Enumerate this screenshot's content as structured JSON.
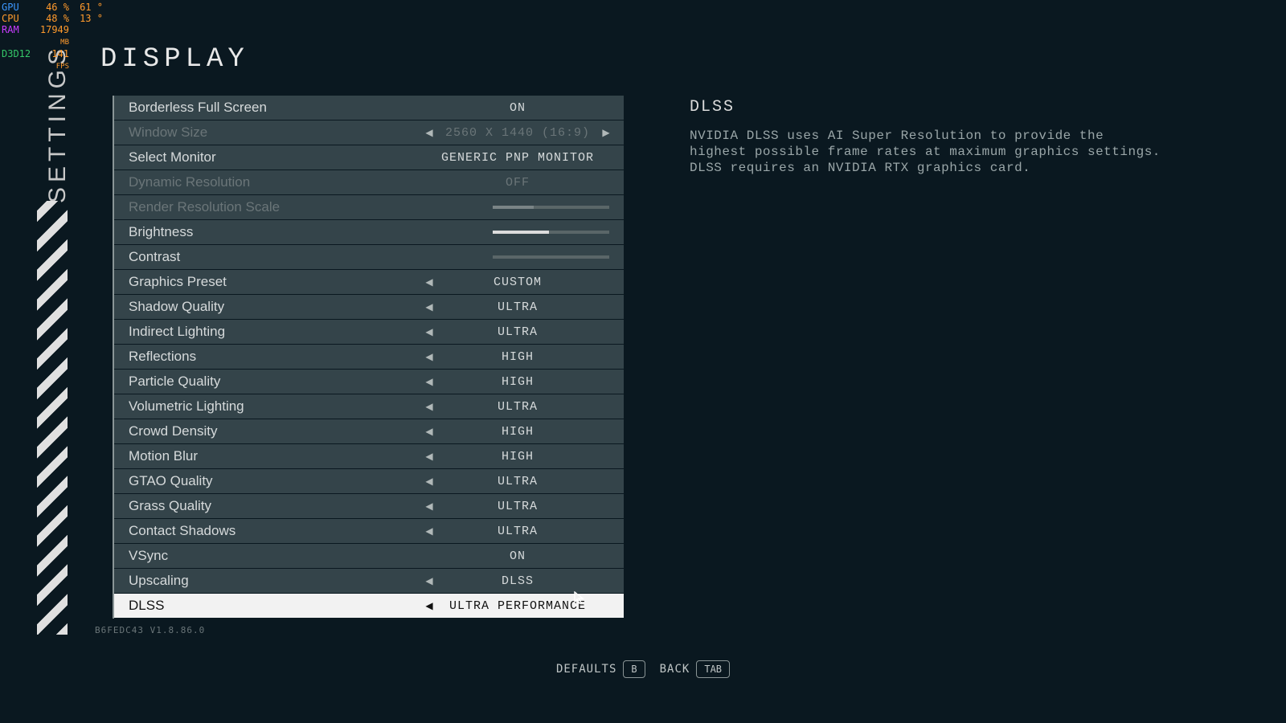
{
  "perf": {
    "gpu": {
      "label": "GPU",
      "v1": "46",
      "u1": "%",
      "v2": "61",
      "u2": "°"
    },
    "cpu": {
      "label": "CPU",
      "v1": "48",
      "u1": "%",
      "v2": "13",
      "u2": "°"
    },
    "ram": {
      "label": "RAM",
      "v1": "17949",
      "u1": "MB"
    },
    "d3d": {
      "label": "D3D12",
      "v1": "141",
      "u1": "FPS"
    }
  },
  "nav": {
    "settings_label": "SETTINGS"
  },
  "page_title": "DISPLAY",
  "settings": [
    {
      "label": "Borderless Full Screen",
      "type": "value",
      "value": "ON",
      "disabled": false,
      "arrows": false
    },
    {
      "label": "Window Size",
      "type": "value",
      "value": "2560 X 1440 (16:9)",
      "disabled": true,
      "arrows": true,
      "both_arrows": true
    },
    {
      "label": "Select Monitor",
      "type": "value",
      "value": "GENERIC PNP MONITOR",
      "disabled": false,
      "arrows": false
    },
    {
      "label": "Dynamic Resolution",
      "type": "value",
      "value": "OFF",
      "disabled": true,
      "arrows": false
    },
    {
      "label": "Render Resolution Scale",
      "type": "slider",
      "value": 35,
      "disabled": true
    },
    {
      "label": "Brightness",
      "type": "slider",
      "value": 48,
      "disabled": false
    },
    {
      "label": "Contrast",
      "type": "slider",
      "value": 0,
      "disabled": false
    },
    {
      "label": "Graphics Preset",
      "type": "value",
      "value": "CUSTOM",
      "disabled": false,
      "arrows": true
    },
    {
      "label": "Shadow Quality",
      "type": "value",
      "value": "ULTRA",
      "disabled": false,
      "arrows": true
    },
    {
      "label": "Indirect Lighting",
      "type": "value",
      "value": "ULTRA",
      "disabled": false,
      "arrows": true
    },
    {
      "label": "Reflections",
      "type": "value",
      "value": "HIGH",
      "disabled": false,
      "arrows": true
    },
    {
      "label": "Particle Quality",
      "type": "value",
      "value": "HIGH",
      "disabled": false,
      "arrows": true
    },
    {
      "label": "Volumetric Lighting",
      "type": "value",
      "value": "ULTRA",
      "disabled": false,
      "arrows": true
    },
    {
      "label": "Crowd Density",
      "type": "value",
      "value": "HIGH",
      "disabled": false,
      "arrows": true
    },
    {
      "label": "Motion Blur",
      "type": "value",
      "value": "HIGH",
      "disabled": false,
      "arrows": true
    },
    {
      "label": "GTAO Quality",
      "type": "value",
      "value": "ULTRA",
      "disabled": false,
      "arrows": true
    },
    {
      "label": "Grass Quality",
      "type": "value",
      "value": "ULTRA",
      "disabled": false,
      "arrows": true
    },
    {
      "label": "Contact Shadows",
      "type": "value",
      "value": "ULTRA",
      "disabled": false,
      "arrows": true
    },
    {
      "label": "VSync",
      "type": "value",
      "value": "ON",
      "disabled": false,
      "arrows": false
    },
    {
      "label": "Upscaling",
      "type": "value",
      "value": "DLSS",
      "disabled": false,
      "arrows": true
    },
    {
      "label": "DLSS",
      "type": "value",
      "value": "ULTRA PERFORMANCE",
      "disabled": false,
      "arrows": true,
      "selected": true
    }
  ],
  "info": {
    "title": "DLSS",
    "description": "NVIDIA DLSS uses AI Super Resolution to provide the highest possible frame rates at maximum graphics settings. DLSS requires an NVIDIA RTX graphics card."
  },
  "version": "B6FEDC43 V1.8.86.0",
  "footer": {
    "defaults": {
      "label": "DEFAULTS",
      "key": "B"
    },
    "back": {
      "label": "BACK",
      "key": "TAB"
    }
  }
}
